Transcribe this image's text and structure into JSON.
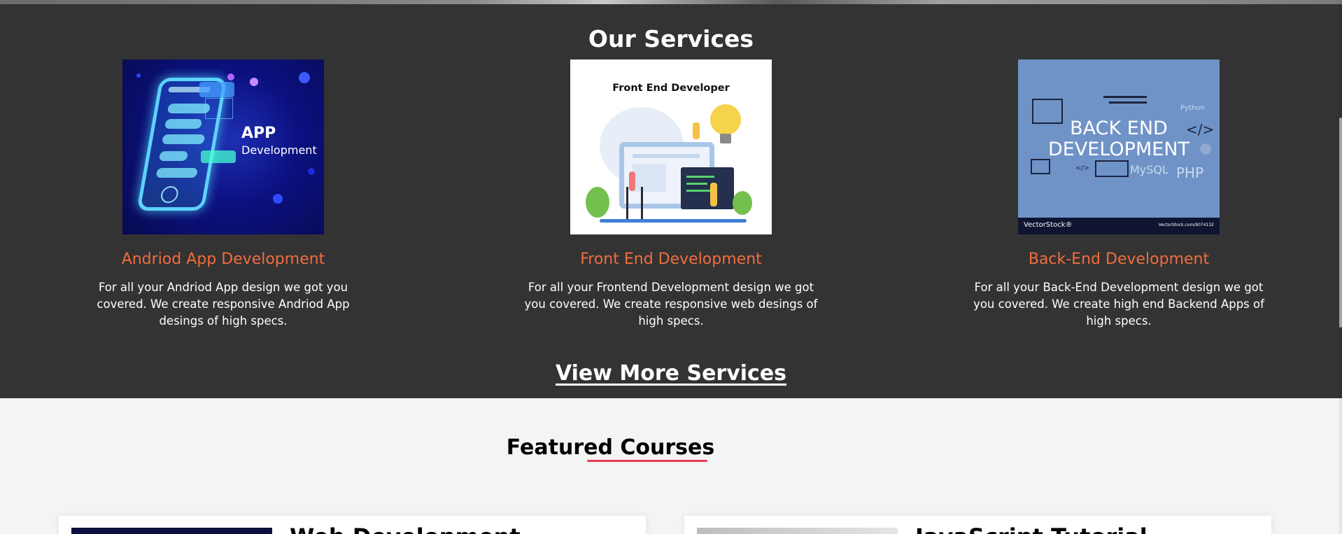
{
  "services": {
    "title": "Our Services",
    "items": [
      {
        "title": "Andriod App Development",
        "description": "For all your Andriod App design we got you covered. We create responsive Andriod App desings of high specs.",
        "image": {
          "icon": "mobile-app-illustration",
          "text_main": "APP",
          "text_sub": "Development"
        }
      },
      {
        "title": "Front End Development",
        "description": "For all your Frontend Development design we got you covered. We create responsive web desings of high specs.",
        "image": {
          "icon": "frontend-developer-illustration",
          "heading": "Front End Developer"
        }
      },
      {
        "title": "Back-End Development",
        "description": "For all your Back-End Development design we got you covered. We create high end Backend Apps of high specs.",
        "image": {
          "icon": "backend-development-illustration",
          "line1": "BACK END",
          "line2": "DEVELOPMENT",
          "tags": [
            "Python",
            "</>",
            "MySQL",
            "PHP",
            "</>"
          ],
          "brand": "VectorStock®",
          "url": "VectorStock.com/9074132"
        }
      }
    ],
    "view_more": "View More Services"
  },
  "featured": {
    "title": "Featured Courses",
    "courses": [
      {
        "title": "Web Development"
      },
      {
        "title": "JavaScript Tutorial"
      }
    ]
  },
  "colors": {
    "services_bg": "#333333",
    "accent_orange": "#f26d3d",
    "underline_red": "#e43b4f",
    "page_bg": "#f4f4f5"
  }
}
